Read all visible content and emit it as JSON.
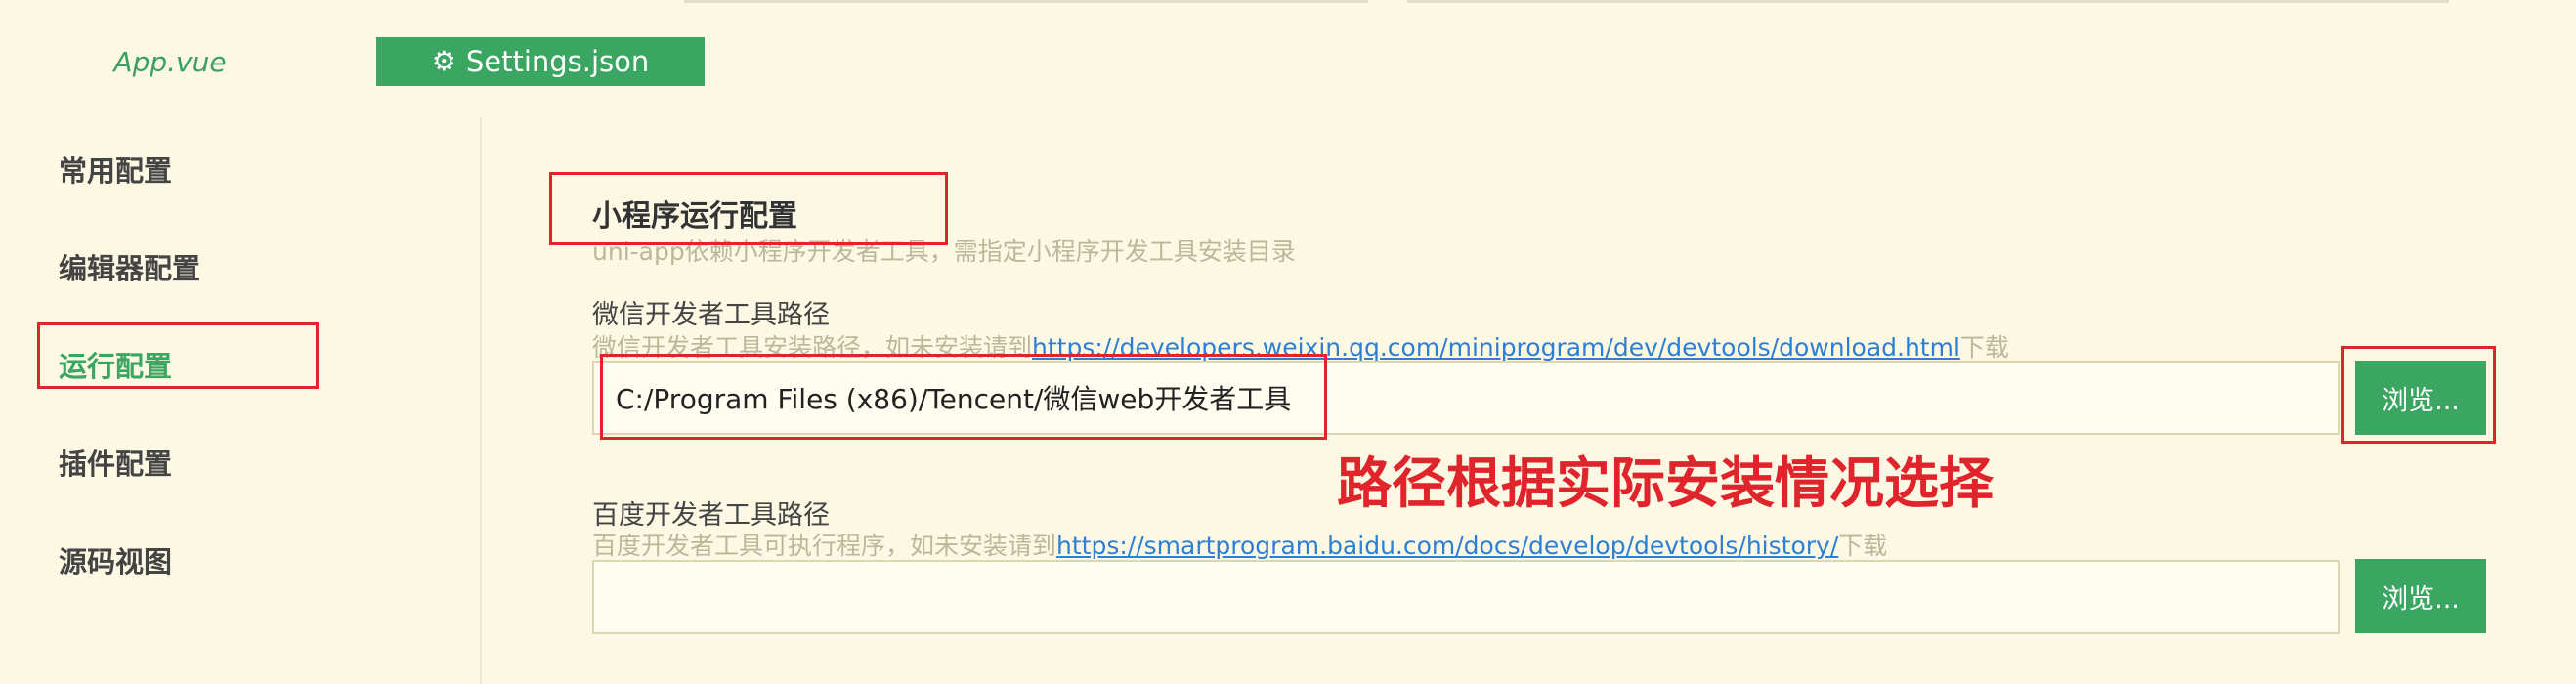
{
  "tabs": {
    "app_label": "App.vue",
    "settings_label": "Settings.json"
  },
  "sidebar": {
    "items": [
      {
        "label": "常用配置"
      },
      {
        "label": "编辑器配置"
      },
      {
        "label": "运行配置"
      },
      {
        "label": "插件配置"
      },
      {
        "label": "源码视图"
      }
    ],
    "active_index": 2
  },
  "main": {
    "section_title": "小程序运行配置",
    "section_desc": "uni-app依赖小程序开发者工具，需指定小程序开发工具安装目录",
    "wechat": {
      "label": "微信开发者工具路径",
      "help_prefix": "微信开发者工具安装路径，如未安装请到",
      "help_link": "https://developers.weixin.qq.com/miniprogram/dev/devtools/download.html",
      "help_suffix": "下载",
      "value": "C:/Program Files (x86)/Tencent/微信web开发者工具",
      "browse_label": "浏览..."
    },
    "baidu": {
      "label": "百度开发者工具路径",
      "help_prefix": "百度开发者工具可执行程序，如未安装请到",
      "help_link": "https://smartprogram.baidu.com/docs/develop/devtools/history/",
      "help_suffix": "下载",
      "value": "",
      "browse_label": "浏览..."
    }
  },
  "annotation": "路径根据实际安装情况选择",
  "colors": {
    "background": "#fcf8e4",
    "accent_green": "#3aa662",
    "annotation_red": "#e0242c",
    "link_blue": "#2d7fd4"
  },
  "icons": {
    "settings_tab": "gear-icon"
  }
}
